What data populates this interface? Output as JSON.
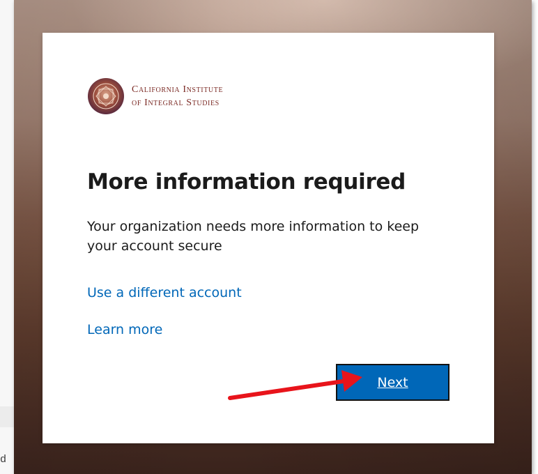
{
  "organization": {
    "name_line1": "California Institute",
    "name_line2": "of Integral Studies",
    "logo_icon": "mandala-logo-icon"
  },
  "dialog": {
    "title": "More information required",
    "description": "Your organization needs more information to keep your account secure",
    "use_different_account_label": "Use a different account",
    "learn_more_label": "Learn more",
    "next_label": "Next"
  },
  "background_fragment": {
    "text": "od"
  },
  "annotation": {
    "arrow_color": "#e8141b",
    "arrow_icon": "red-arrow-icon"
  },
  "colors": {
    "link": "#0067b8",
    "button": "#0067b8",
    "brand": "#7b2a24"
  }
}
